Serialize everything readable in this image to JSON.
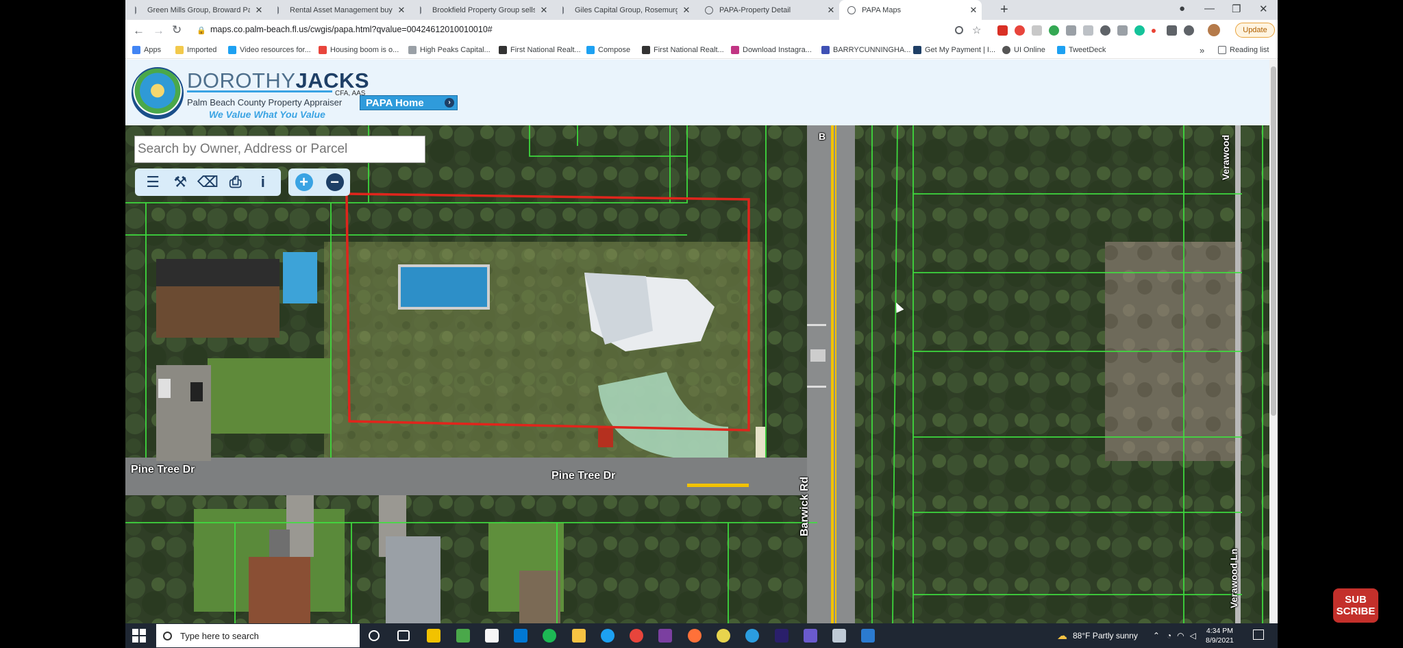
{
  "browser": {
    "tabs": [
      {
        "label": "Green Mills Group, Broward Parts",
        "active": false
      },
      {
        "label": "Rental Asset Management buys",
        "active": false
      },
      {
        "label": "Brookfield Property Group sells",
        "active": false
      },
      {
        "label": "Giles Capital Group, Rosemurgy",
        "active": false
      },
      {
        "label": "PAPA-Property Detail",
        "active": false
      },
      {
        "label": "PAPA Maps",
        "active": true
      }
    ],
    "new_tab": "+",
    "window_controls": {
      "minimize": "—",
      "maximize": "❐",
      "close": "✕"
    },
    "nav": {
      "back": "←",
      "forward": "→",
      "reload": "↻"
    },
    "url": "maps.co.palm-beach.fl.us/cwgis/papa.html?qvalue=00424612010010010#",
    "update_button": "Update",
    "bookmarks": [
      {
        "label": "Apps",
        "color": "#4285f4"
      },
      {
        "label": "Imported",
        "color": "#f2c94c"
      },
      {
        "label": "Video resources for...",
        "color": "#1da1f2"
      },
      {
        "label": "Housing boom is o...",
        "color": "#e8453c"
      },
      {
        "label": "High Peaks Capital...",
        "color": "#9aa0a6"
      },
      {
        "label": "First National Realt...",
        "color": "#333333"
      },
      {
        "label": "Compose",
        "color": "#1da1f2"
      },
      {
        "label": "First National Realt...",
        "color": "#333333"
      },
      {
        "label": "Download Instagra...",
        "color": "#c13584"
      },
      {
        "label": "BARRYCUNNINGHA...",
        "color": "#3f51b5"
      },
      {
        "label": "Get My Payment | I...",
        "color": "#1e3f66"
      },
      {
        "label": "UI Online",
        "color": "#555555"
      },
      {
        "label": "TweetDeck",
        "color": "#1da1f2"
      }
    ],
    "bookmarks_more": "»",
    "reading_list": "Reading list"
  },
  "site": {
    "logo_first": "DOROTHY",
    "logo_last": "JACKS",
    "logo_credentials": "CFA, AAS",
    "logo_subtitle": "Palm Beach County Property Appraiser",
    "logo_tagline": "We Value What You Value",
    "papa_home_label": "PAPA Home"
  },
  "map": {
    "search_placeholder": "Search by Owner, Address or Parcel",
    "tools": [
      "layers-icon",
      "wrench-icon",
      "eraser-icon",
      "print-icon",
      "info-icon"
    ],
    "zoom_in": "+",
    "zoom_out": "−",
    "streets": {
      "pine_tree_left": "Pine Tree Dr",
      "pine_tree_center": "Pine Tree Dr",
      "barwick": "Barwick Rd",
      "barwick_top": "B",
      "verawood_top": "Verawood",
      "verawood_bottom": "Verawood Ln"
    },
    "colors": {
      "parcel_lines": "#3fe03f",
      "selection": "#e0251c",
      "road_stripe": "#f2c200"
    }
  },
  "taskbar": {
    "search_placeholder": "Type here to search",
    "weather": "88°F  Partly sunny",
    "time": "4:34 PM",
    "date": "8/9/2021"
  },
  "overlay": {
    "subscribe": "SUB\nSCRIBE"
  }
}
